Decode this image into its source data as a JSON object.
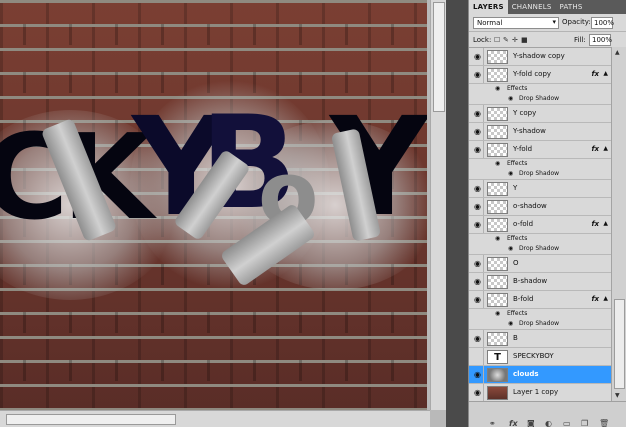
{
  "canvas": {
    "letters": [
      "C",
      "K",
      "Y",
      "B",
      "o",
      "Y"
    ]
  },
  "panel": {
    "tabs": [
      {
        "label": "LAYERS",
        "active": true
      },
      {
        "label": "CHANNELS",
        "active": false
      },
      {
        "label": "PATHS",
        "active": false
      }
    ],
    "blend_mode": "Normal",
    "opacity_label": "Opacity:",
    "opacity_value": "100%",
    "lock_label": "Lock:",
    "fill_label": "Fill:",
    "fill_value": "100%"
  },
  "layers": [
    {
      "name": "Y-shadow copy",
      "visible": true,
      "thumb": "transparent"
    },
    {
      "name": "Y-fold copy",
      "visible": true,
      "thumb": "transparent",
      "fx": "fx",
      "effects": [
        "Effects",
        "Drop Shadow"
      ]
    },
    {
      "name": "Y copy",
      "visible": true,
      "thumb": "transparent"
    },
    {
      "name": "Y-shadow",
      "visible": true,
      "thumb": "transparent"
    },
    {
      "name": "Y-fold",
      "visible": true,
      "thumb": "transparent",
      "fx": "fx",
      "effects": [
        "Effects",
        "Drop Shadow"
      ]
    },
    {
      "name": "Y",
      "visible": true,
      "thumb": "transparent"
    },
    {
      "name": "o-shadow",
      "visible": true,
      "thumb": "transparent"
    },
    {
      "name": "o-fold",
      "visible": true,
      "thumb": "transparent",
      "fx": "fx",
      "effects": [
        "Effects",
        "Drop Shadow"
      ]
    },
    {
      "name": "O",
      "visible": true,
      "thumb": "transparent"
    },
    {
      "name": "B-shadow",
      "visible": true,
      "thumb": "transparent"
    },
    {
      "name": "B-fold",
      "visible": true,
      "thumb": "transparent",
      "fx": "fx",
      "effects": [
        "Effects",
        "Drop Shadow"
      ]
    },
    {
      "name": "B",
      "visible": true,
      "thumb": "transparent"
    },
    {
      "name": "SPECKYBOY",
      "visible": false,
      "thumb": "text",
      "thumb_glyph": "T"
    },
    {
      "name": "clouds",
      "visible": true,
      "thumb": "clouds",
      "selected": true
    },
    {
      "name": "Layer 1 copy",
      "visible": true,
      "thumb": "brick"
    }
  ],
  "icons": {
    "eye": "eye-icon",
    "lock_transparent": "lock-transparent-icon",
    "lock_image": "lock-image-icon",
    "lock_position": "lock-position-icon",
    "lock_all": "lock-all-icon",
    "link": "link-layers-icon",
    "fx": "add-style-icon",
    "mask": "add-mask-icon",
    "adjust": "adjustment-icon",
    "group": "group-icon",
    "new_layer": "new-layer-icon",
    "trash": "trash-icon"
  },
  "colors": {
    "selected_row": "#3399ff",
    "panel_bg": "#d9d9d9",
    "tab_bar": "#5a5a5a"
  }
}
